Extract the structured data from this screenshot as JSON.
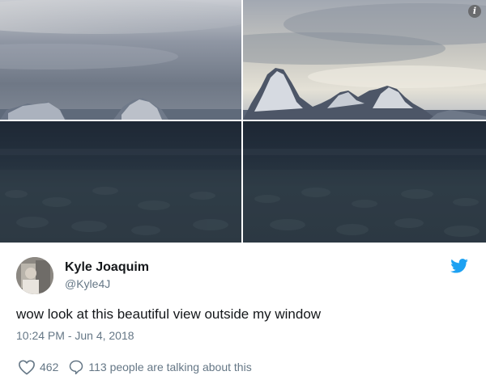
{
  "tweet": {
    "display_name": "Kyle Joaquim",
    "handle": "@Kyle4J",
    "text": "wow look at this beautiful view outside my window",
    "timestamp": "10:24 PM - Jun 4, 2018",
    "like_count": "462",
    "conversation_text": "113 people are talking about this"
  },
  "icons": {
    "info": "info-icon",
    "brand": "twitter-bird-icon",
    "like": "heart-icon",
    "reply": "speech-bubble-icon"
  },
  "colors": {
    "brand": "#1da1f2",
    "secondary_text": "#657786",
    "primary_text": "#14171a"
  }
}
